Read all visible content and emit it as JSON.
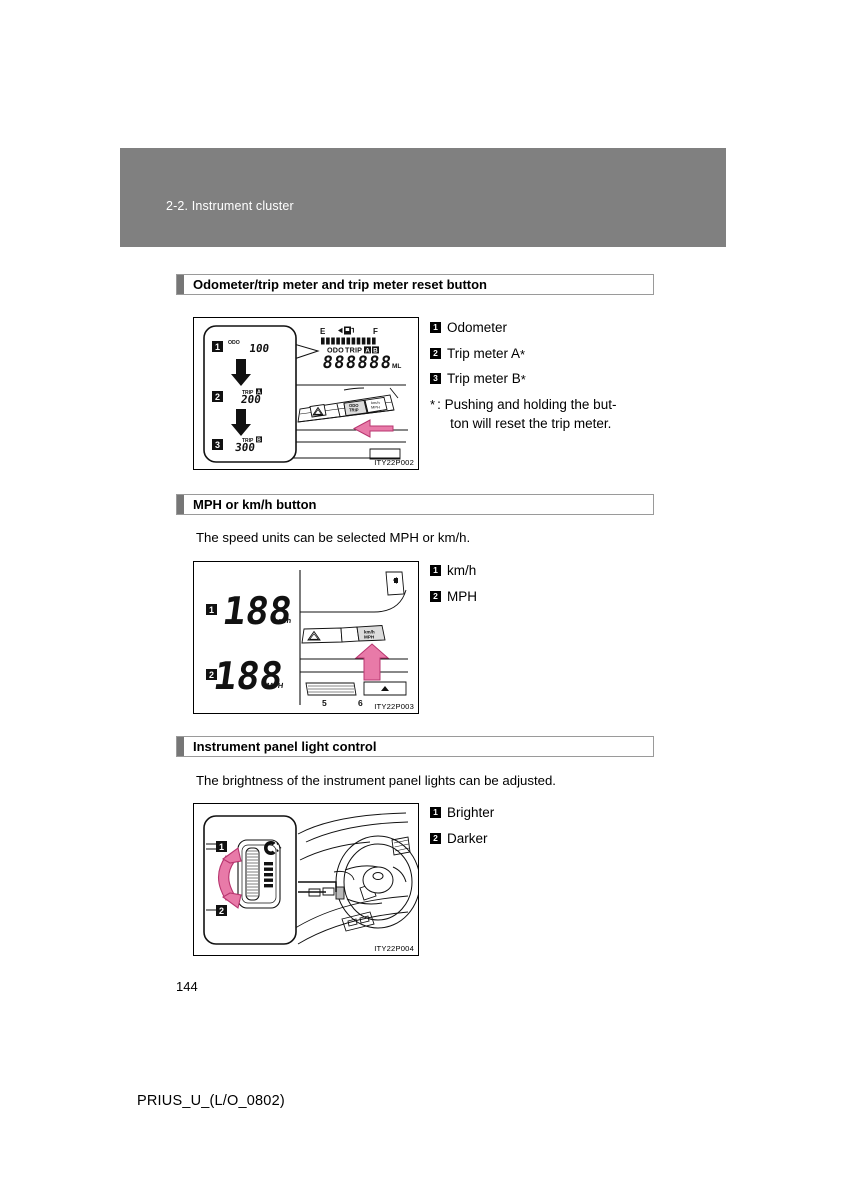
{
  "page": {
    "chapter_header": "2-2. Instrument cluster",
    "page_number": "144",
    "footer": "PRIUS_U_(L/O_0802)",
    "header_band_color": "#808080"
  },
  "sections": [
    {
      "id": "odometer",
      "title": "Odometer/trip meter and trip meter reset button",
      "intro": "",
      "figure": {
        "code": "ITY22P002",
        "display": {
          "fuel_left_label": "E",
          "fuel_right_label": "F",
          "fuel_icon": "fuel-pump-icon",
          "mode_labels": "ODO TRIP",
          "trip_a": "A",
          "trip_b": "B",
          "odo_digits": "888888",
          "unit": "ML"
        },
        "steps": [
          {
            "badge": "1",
            "mode": "ODO",
            "value": "100",
            "sub": ""
          },
          {
            "badge": "2",
            "mode": "TRIP",
            "value": "200",
            "sub": "A"
          },
          {
            "badge": "3",
            "mode": "TRIP",
            "value": "300",
            "sub": "B"
          }
        ]
      },
      "callouts": [
        {
          "badge": "1",
          "label": "Odometer",
          "star": ""
        },
        {
          "badge": "2",
          "label": "Trip meter A",
          "star": "*"
        },
        {
          "badge": "3",
          "label": "Trip meter B",
          "star": "*"
        }
      ],
      "footnote": {
        "mark": "*",
        "line1": ": Pushing and holding the but-",
        "line2": "ton will reset the trip meter."
      }
    },
    {
      "id": "mph-kmh",
      "title": "MPH or km/h button",
      "intro": "The speed units can be selected MPH or km/h.",
      "figure": {
        "code": "ITY22P003",
        "button_label_top": "km/h",
        "button_label_bottom": "MPH",
        "speed_value": "188",
        "unit_top": "km/h",
        "unit_bottom": "MPH",
        "scale_labels": [
          "5",
          "6"
        ],
        "hazard_icon": "hazard-triangle-icon"
      },
      "callouts": [
        {
          "badge": "1",
          "label": "km/h",
          "star": ""
        },
        {
          "badge": "2",
          "label": "MPH",
          "star": ""
        }
      ],
      "footnote": null
    },
    {
      "id": "panel-light",
      "title": "Instrument panel light control",
      "intro": "The brightness of the instrument panel lights can be adjusted.",
      "figure": {
        "code": "ITY22P004",
        "dial_icon": "brightness-dial-icon",
        "badges": [
          "1",
          "2"
        ]
      },
      "callouts": [
        {
          "badge": "1",
          "label": "Brighter",
          "star": ""
        },
        {
          "badge": "2",
          "label": "Darker",
          "star": ""
        }
      ],
      "footnote": null
    }
  ],
  "colors": {
    "arrow_pink": "#e87aa8",
    "arrow_pink_dark": "#c9417c",
    "band_gray": "#808080",
    "tab_gray": "#767676"
  }
}
